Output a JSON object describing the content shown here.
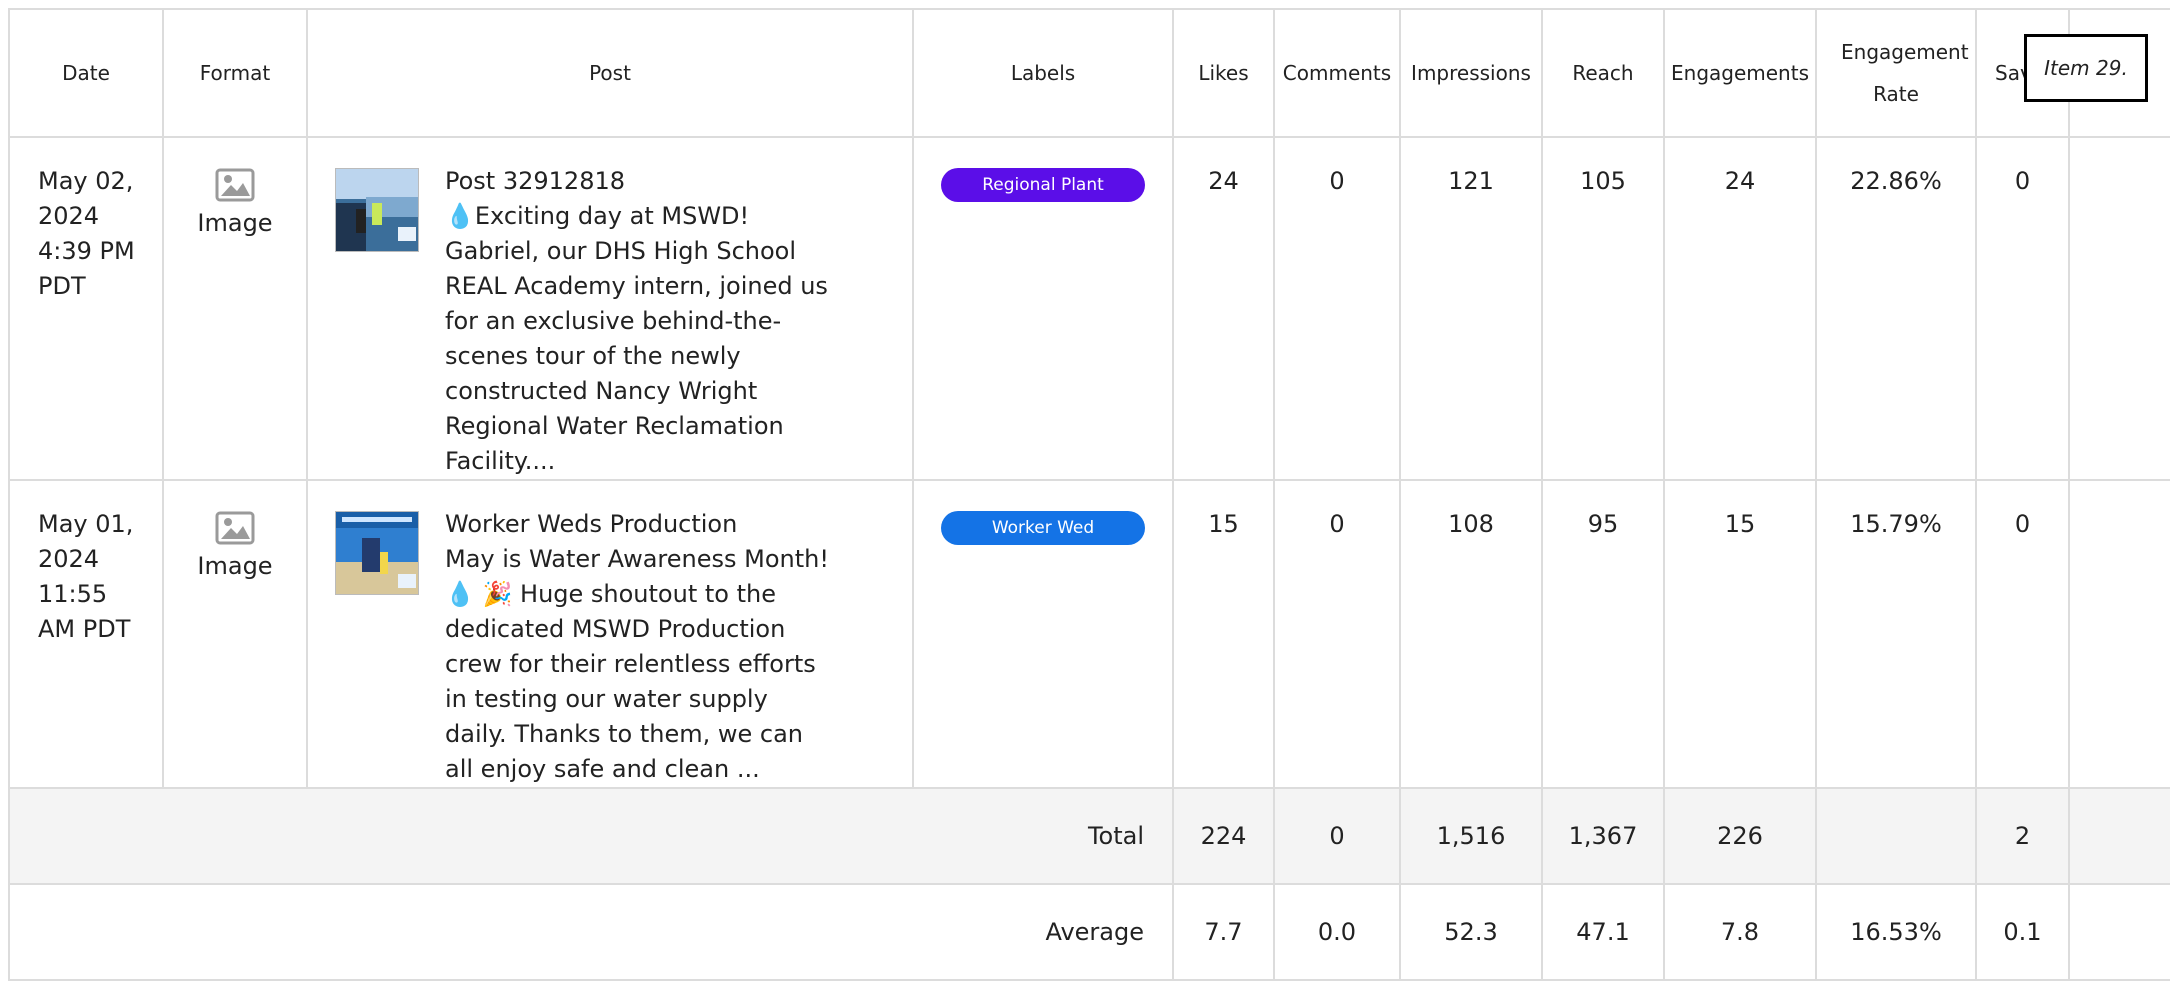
{
  "columns": [
    "Date",
    "Format",
    "Post",
    "Labels",
    "Likes",
    "Comments",
    "Impressions",
    "Reach",
    "Engagements",
    "Engagement Rate",
    "Sav"
  ],
  "posts": [
    {
      "date": "May 02, 2024 4:39 PM PDT",
      "format": "Image",
      "title": "Post 32912818",
      "text_emoji": "💧",
      "text": "Exciting day at MSWD! Gabriel, our DHS High School REAL Academy intern, joined us for an exclusive behind-the-scenes tour of the newly constructed Nancy Wright Regional Water Reclamation Facility....",
      "label": "Regional Plant",
      "label_color": "#5b0ee8",
      "likes": "24",
      "comments": "0",
      "impressions": "121",
      "reach": "105",
      "engagements": "24",
      "engagement_rate": "22.86%",
      "saves": "0"
    },
    {
      "date": "May 01, 2024 11:55 AM PDT",
      "format": "Image",
      "title": "Worker Weds Production",
      "text": "May is Water Awareness Month! 💧 🎉 Huge shoutout to the dedicated MSWD Production crew for their relentless efforts in testing our water supply daily. Thanks to them, we can all enjoy safe and clean ...",
      "label": "Worker Wed",
      "label_color": "#1473e6",
      "likes": "15",
      "comments": "0",
      "impressions": "108",
      "reach": "95",
      "engagements": "15",
      "engagement_rate": "15.79%",
      "saves": "0"
    }
  ],
  "total": {
    "label": "Total",
    "likes": "224",
    "comments": "0",
    "impressions": "1,516",
    "reach": "1,367",
    "engagements": "226",
    "engagement_rate": "",
    "saves": "2"
  },
  "average": {
    "label": "Average",
    "likes": "7.7",
    "comments": "0.0",
    "impressions": "52.3",
    "reach": "47.1",
    "engagements": "7.8",
    "engagement_rate": "16.53%",
    "saves": "0.1"
  },
  "item_tag": "Item 29.",
  "icons": {
    "format": "image-icon"
  }
}
